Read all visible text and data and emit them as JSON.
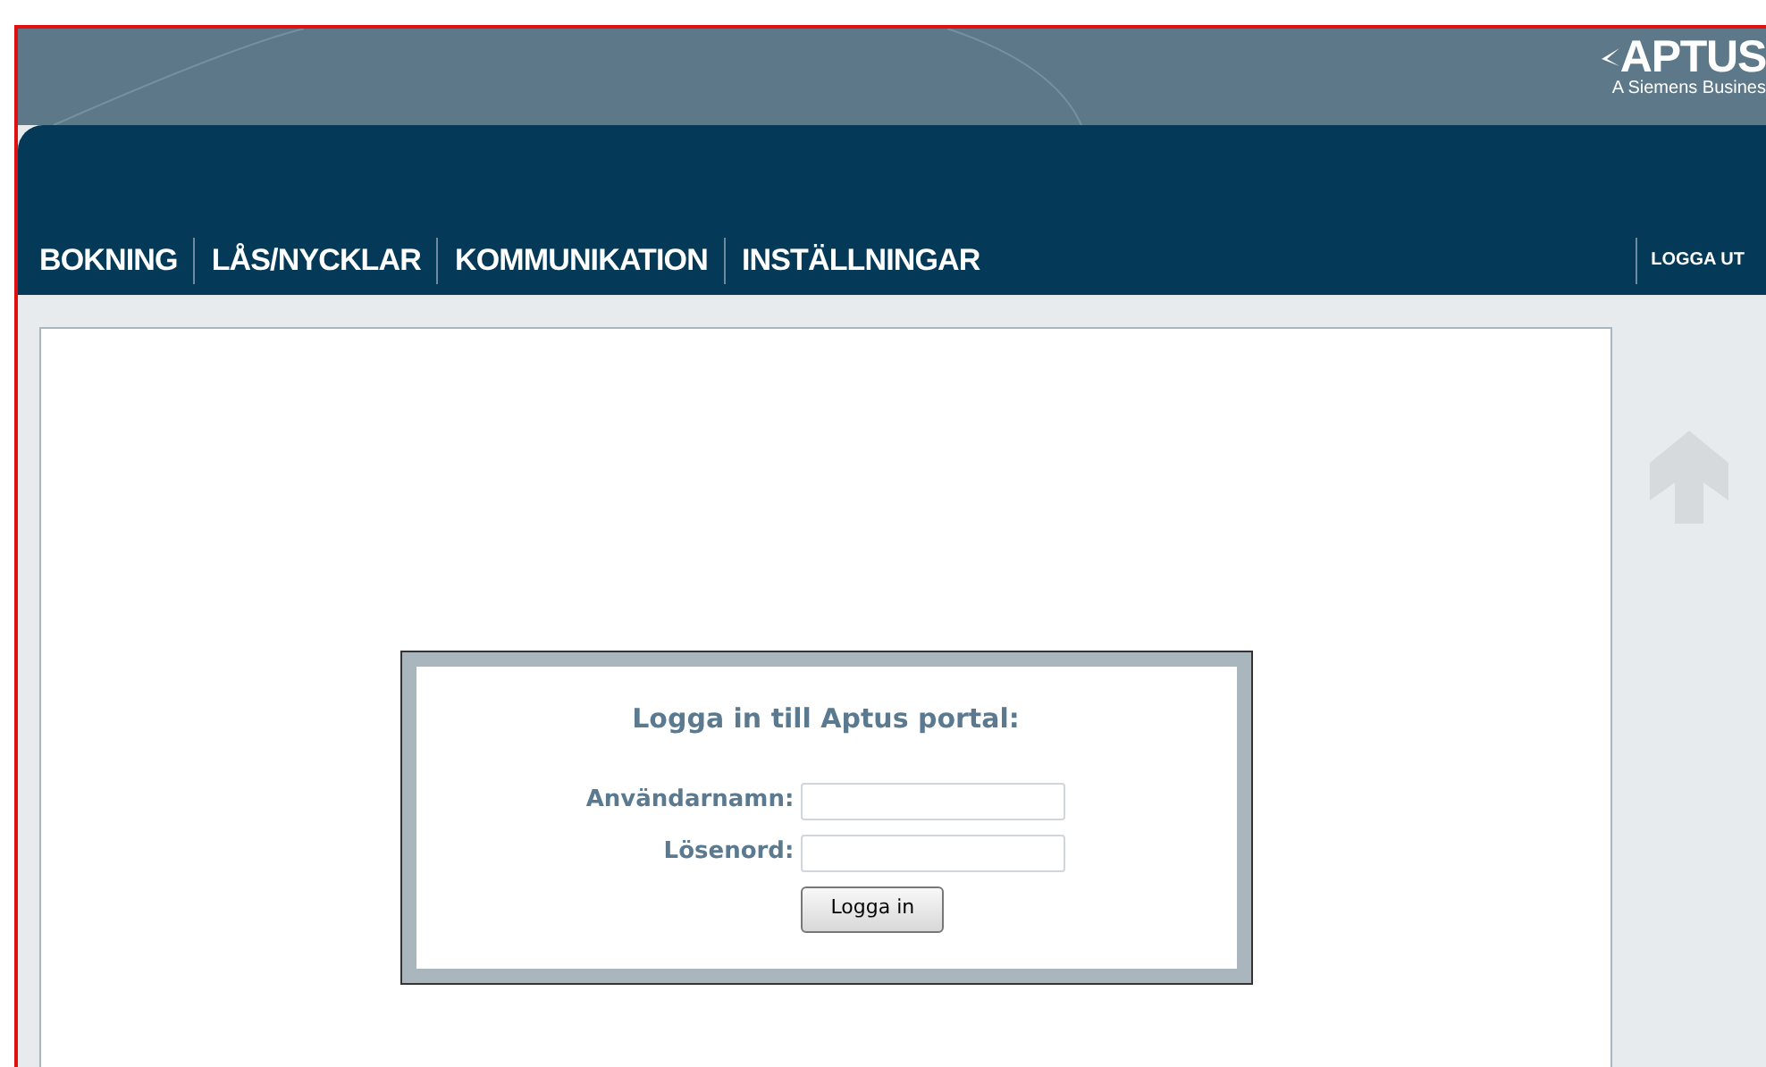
{
  "logo": {
    "name": "APTUS",
    "tagline": "A Siemens Busines"
  },
  "nav": [
    {
      "label": "BOKNING"
    },
    {
      "label": "LÅS/NYCKLAR"
    },
    {
      "label": "KOMMUNIKATION"
    },
    {
      "label": "INSTÄLLNINGAR"
    }
  ],
  "logout": "LOGGA UT",
  "login": {
    "title": "Logga in till Aptus portal:",
    "fields": [
      {
        "label": "Användarnamn:"
      },
      {
        "label": "Lösenord:"
      }
    ],
    "button": "Logga in"
  }
}
